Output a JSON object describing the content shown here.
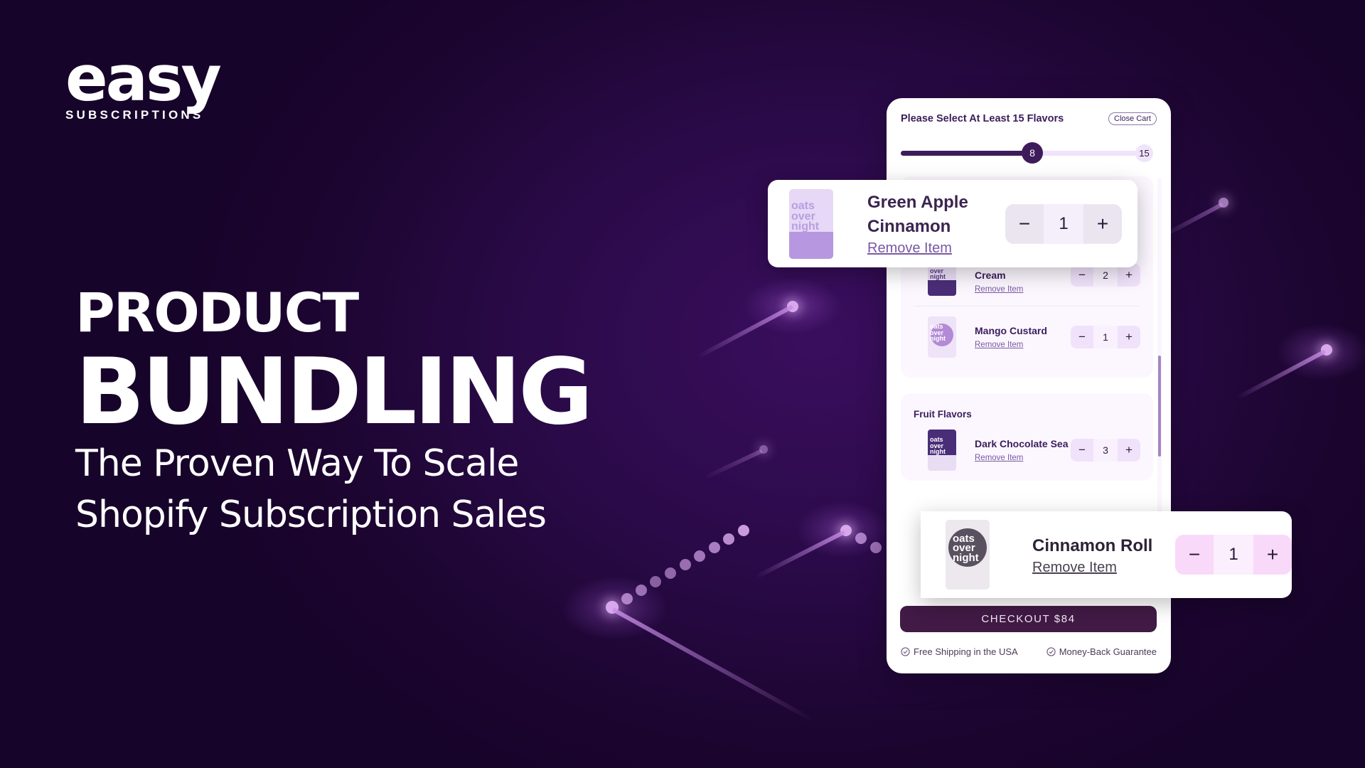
{
  "brand": {
    "logo_word": "easy",
    "logo_sub": "SUBSCRIPTIONS"
  },
  "hero": {
    "line1": "PRODUCT",
    "line2": "BUNDLING",
    "subtitle_line1": "The Proven Way To Scale",
    "subtitle_line2": "Shopify Subscription Sales"
  },
  "cart": {
    "title": "Please Select At Least 15 Flavors",
    "close_label": "Close Cart",
    "progress": {
      "current": 8,
      "target": 15,
      "current_label": "8",
      "target_label": "15"
    },
    "sections": [
      {
        "title": "",
        "items": [
          {
            "name": "Green Apple Cinnamon",
            "qty": "1",
            "remove_label": "Remove Item",
            "pack": "light"
          },
          {
            "name": "Strawberries & Cream",
            "qty": "2",
            "remove_label": "Remove Item",
            "pack": "light-dark"
          },
          {
            "name": "Mango Custard",
            "qty": "1",
            "remove_label": "Remove Item",
            "pack": "circle"
          }
        ]
      },
      {
        "title": "Fruit Flavors",
        "items": [
          {
            "name": "Dark Chocolate Sea",
            "qty": "3",
            "remove_label": "Remove Item",
            "pack": "dark"
          },
          {
            "name": "Cinnamon Roll",
            "qty": "1",
            "remove_label": "Remove Item",
            "pack": "grey"
          }
        ]
      }
    ],
    "checkout_label": "CHECKOUT $84",
    "badges": [
      "Free Shipping in the USA",
      "Money-Back Guarantee"
    ]
  },
  "popouts": {
    "green": {
      "name_line1": "Green Apple",
      "name_line2": "Cinnamon",
      "remove_label": "Remove Item",
      "qty": "1"
    },
    "cinnamon": {
      "name": "Cinnamon Roll",
      "remove_label": "Remove Item",
      "qty": "1"
    }
  },
  "icons": {
    "minus": "−",
    "plus": "+",
    "check": "check-circle-icon"
  },
  "pack_text": {
    "l1": "oats",
    "l2": "over",
    "l3": "night"
  },
  "colors": {
    "accent_dark": "#3e1c5c",
    "checkout_bg": "#411a45",
    "bg": "#2a0a48"
  }
}
